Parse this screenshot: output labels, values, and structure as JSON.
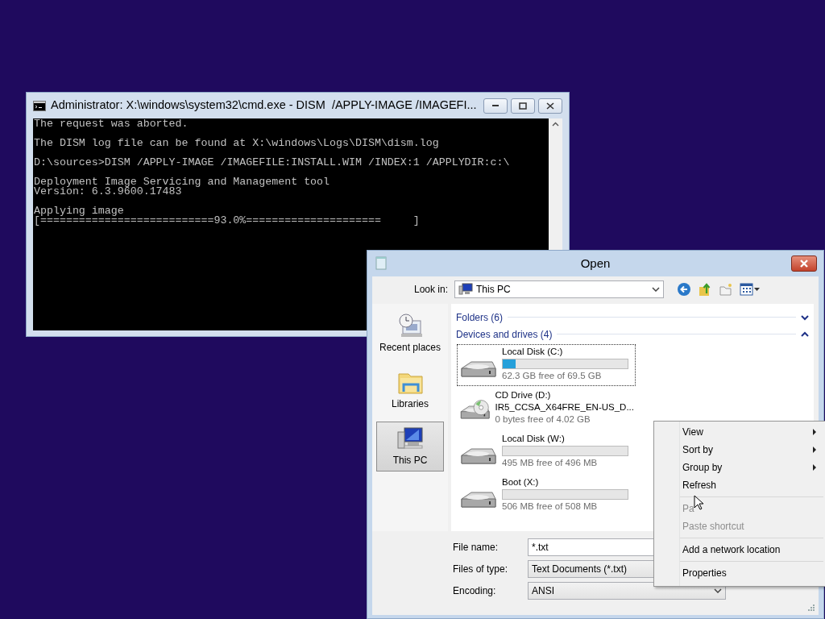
{
  "cmd_window": {
    "title": "Administrator: X:\\windows\\system32\\cmd.exe - DISM  /APPLY-IMAGE /IMAGEFI...",
    "console_blocks": [
      [
        "The request was aborted."
      ],
      [
        "The DISM log file can be found at X:\\windows\\Logs\\DISM\\dism.log"
      ],
      [
        "D:\\sources>DISM /APPLY-IMAGE /IMAGEFILE:INSTALL.WIM /INDEX:1 /APPLYDIR:c:\\"
      ],
      [
        "Deployment Image Servicing and Management tool",
        "Version: 6.3.9600.17483"
      ],
      [
        "Applying image",
        "[===========================93.0%=====================     ]"
      ]
    ]
  },
  "open_dialog": {
    "title": "Open",
    "look_in_label": "Look in:",
    "look_in_value": "This PC",
    "places": [
      {
        "label": "Recent places",
        "kind": "recent",
        "selected": false
      },
      {
        "label": "Libraries",
        "kind": "libraries",
        "selected": false
      },
      {
        "label": "This PC",
        "kind": "pc",
        "selected": true
      }
    ],
    "groups": [
      {
        "label": "Folders (6)",
        "expanded": false
      },
      {
        "label": "Devices and drives (4)",
        "expanded": true
      }
    ],
    "drives": [
      {
        "name": "Local Disk (C:)",
        "kind": "disk",
        "level": 0.1,
        "free": "62.3 GB free of 69.5 GB",
        "selected": true
      },
      {
        "name": "CD Drive (D:)",
        "kind": "cd",
        "volume": "IR5_CCSA_X64FRE_EN-US_D...",
        "free": "0 bytes free of 4.02 GB",
        "selected": false
      },
      {
        "name": "Local Disk (W:)",
        "kind": "disk",
        "level": 0,
        "free": "495 MB free of 496 MB",
        "selected": false
      },
      {
        "name": "Boot (X:)",
        "kind": "disk",
        "level": 0,
        "free": "506 MB free of 508 MB",
        "selected": false
      }
    ],
    "fields": [
      {
        "label": "File name:",
        "kind": "input",
        "value": "*.txt"
      },
      {
        "label": "Files of type:",
        "kind": "select",
        "value": "Text Documents (*.txt)"
      },
      {
        "label": "Encoding:",
        "kind": "select",
        "value": "ANSI"
      }
    ]
  },
  "context_menu": {
    "groups": [
      [
        {
          "label": "View",
          "submenu": true,
          "disabled": false
        },
        {
          "label": "Sort by",
          "submenu": true,
          "disabled": false
        },
        {
          "label": "Group by",
          "submenu": true,
          "disabled": false
        },
        {
          "label": "Refresh",
          "submenu": false,
          "disabled": false
        }
      ],
      [
        {
          "label": "Pa",
          "submenu": false,
          "disabled": true
        },
        {
          "label": "Paste shortcut",
          "submenu": false,
          "disabled": true
        }
      ],
      [
        {
          "label": "Add a network location",
          "submenu": false,
          "disabled": false
        }
      ],
      [
        {
          "label": "Properties",
          "submenu": false,
          "disabled": false
        }
      ]
    ]
  }
}
